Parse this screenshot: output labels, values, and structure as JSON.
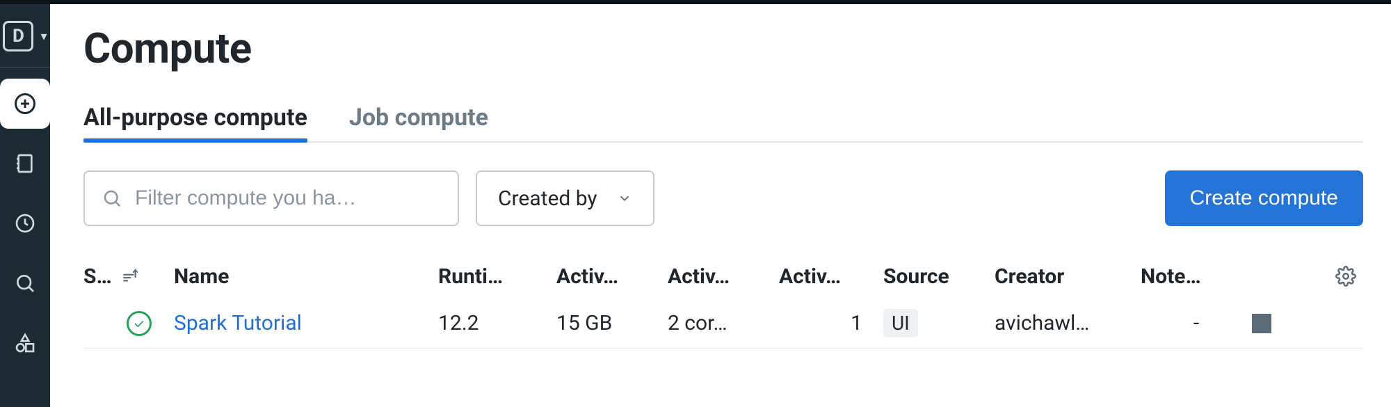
{
  "sidebar": {
    "brand_letter": "D"
  },
  "page": {
    "title": "Compute"
  },
  "tabs": [
    {
      "label": "All-purpose compute",
      "active": true
    },
    {
      "label": "Job compute",
      "active": false
    }
  ],
  "filter": {
    "placeholder": "Filter compute you ha…"
  },
  "created_by_dropdown": {
    "label": "Created by"
  },
  "create_button": {
    "label": "Create compute"
  },
  "columns": {
    "state": "S…",
    "name": "Name",
    "runtime": "Runti…",
    "active_mem": "Activ…",
    "active_cores": "Activ…",
    "active_nodes": "Activ…",
    "source": "Source",
    "creator": "Creator",
    "notebooks": "Note…"
  },
  "rows": [
    {
      "state": "running",
      "name": "Spark Tutorial",
      "runtime": "12.2",
      "active_mem": "15 GB",
      "active_cores": "2 cor…",
      "active_nodes": "1",
      "source": "UI",
      "creator": "avichawl…",
      "notebooks": "-"
    }
  ]
}
